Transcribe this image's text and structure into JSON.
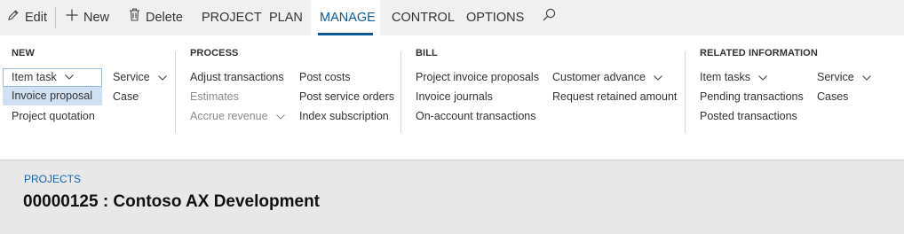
{
  "toolbar": {
    "edit_label": "Edit",
    "new_label": "New",
    "delete_label": "Delete",
    "tabs": [
      {
        "label": "PROJECT"
      },
      {
        "label": "PLAN"
      },
      {
        "label": "MANAGE"
      },
      {
        "label": "CONTROL"
      },
      {
        "label": "OPTIONS"
      }
    ],
    "active_tab": "MANAGE",
    "search_icon": "search-icon"
  },
  "ribbon": {
    "new": {
      "title": "NEW",
      "item_task": "Item task",
      "invoice_proposal": "Invoice proposal",
      "project_quotation": "Project quotation",
      "service": "Service",
      "case": "Case"
    },
    "process": {
      "title": "PROCESS",
      "adjust_transactions": "Adjust transactions",
      "estimates": "Estimates",
      "accrue_revenue": "Accrue revenue",
      "post_costs": "Post costs",
      "post_service_orders": "Post service orders",
      "index_subscription": "Index subscription"
    },
    "bill": {
      "title": "BILL",
      "project_invoice_proposals": "Project invoice proposals",
      "invoice_journals": "Invoice journals",
      "on_account_transactions": "On-account transactions",
      "customer_advance": "Customer advance",
      "request_retained_amount": "Request retained amount"
    },
    "related": {
      "title": "RELATED INFORMATION",
      "item_tasks": "Item tasks",
      "pending_transactions": "Pending transactions",
      "posted_transactions": "Posted transactions",
      "service": "Service",
      "cases": "Cases"
    }
  },
  "header": {
    "breadcrumb": "PROJECTS",
    "title": "00000125 : Contoso AX Development"
  },
  "colors": {
    "accent": "#0b5a97",
    "selected_bg": "#cfe1f3",
    "toolbar_bg": "#f0f0f0",
    "header_bg": "#e8e8e8",
    "link": "#1565b0"
  }
}
